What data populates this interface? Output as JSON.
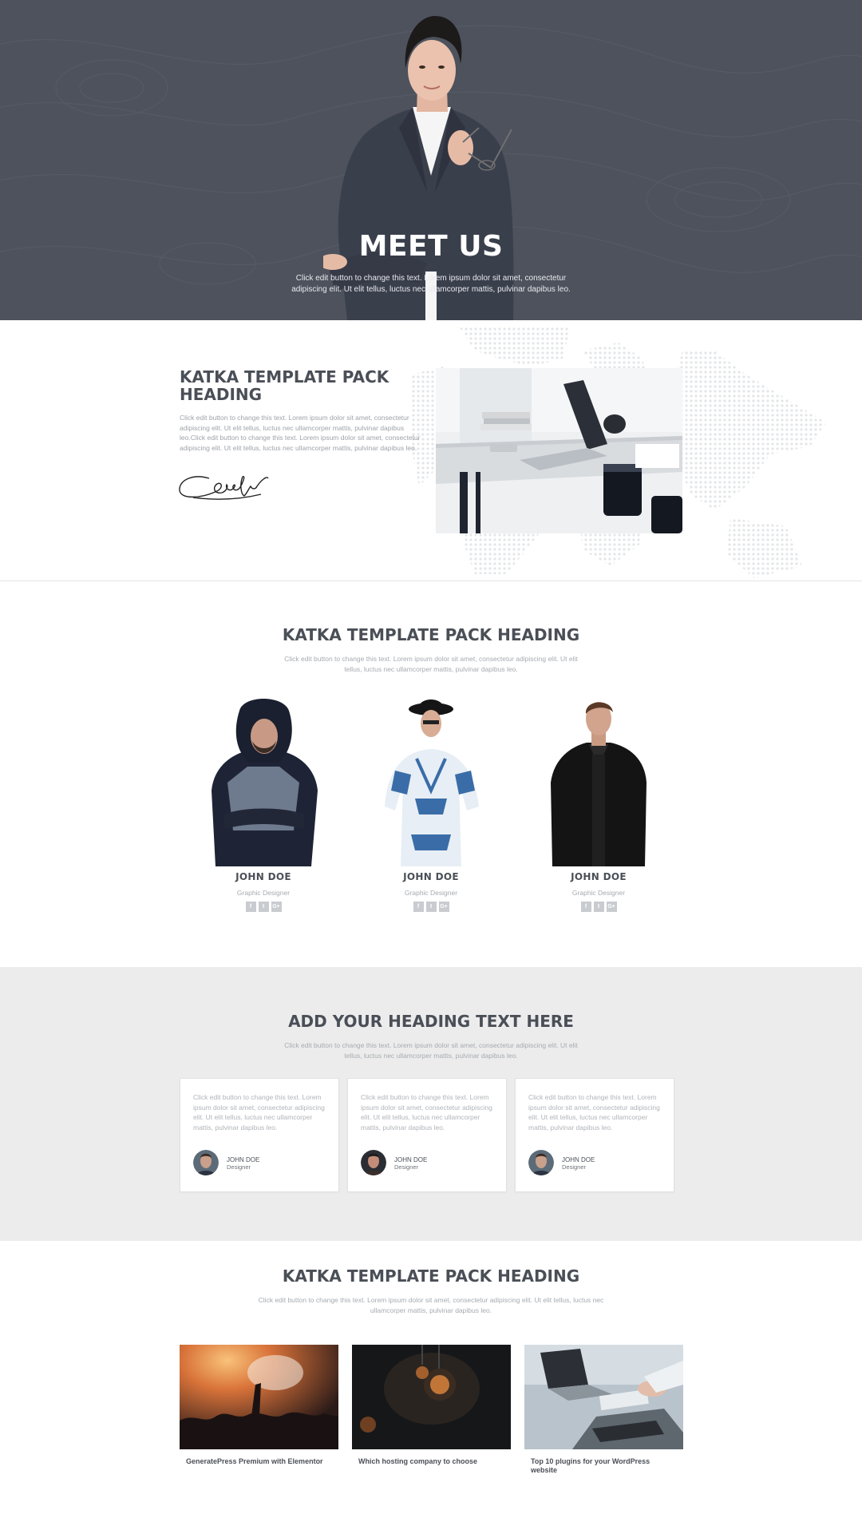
{
  "hero": {
    "title": "MEET US",
    "text": "Click edit button to change this text. Lorem ipsum dolor sit amet, consectetur adipiscing elit. Ut elit tellus, luctus nec ullamcorper mattis, pulvinar dapibus leo."
  },
  "about": {
    "heading": "KATKA TEMPLATE PACK HEADING",
    "text": "Click edit button to change this text. Lorem ipsum dolor sit amet, consectetur adipiscing elit. Ut elit tellus, luctus nec ullamcorper mattis, pulvinar dapibus leo.Click edit button to change this text. Lorem ipsum dolor sit amet, consectetur adipiscing elit. Ut elit tellus, luctus nec ullamcorper mattis, pulvinar dapibus leo."
  },
  "team": {
    "heading": "KATKA TEMPLATE PACK HEADING",
    "subtext": "Click edit button to change this text. Lorem ipsum dolor sit amet, consectetur adipiscing elit. Ut elit tellus, luctus nec ullamcorper mattis, pulvinar dapibus leo.",
    "members": [
      {
        "name": "JOHN DOE",
        "role": "Graphic Designer"
      },
      {
        "name": "JOHN DOE",
        "role": "Graphic Designer"
      },
      {
        "name": "JOHN DOE",
        "role": "Graphic Designer"
      }
    ],
    "social_icons": [
      "f",
      "t",
      "G+"
    ]
  },
  "testimonials": {
    "heading": "ADD YOUR HEADING TEXT HERE",
    "subtext": "Click edit button to change this text. Lorem ipsum dolor sit amet, consectetur adipiscing elit. Ut elit tellus, luctus nec ullamcorper mattis, pulvinar dapibus leo.",
    "cards": [
      {
        "text": "Click edit button to change this text. Lorem ipsum dolor sit amet, consectetur adipiscing elit. Ut elit tellus, luctus nec ullamcorper mattis, pulvinar dapibus leo.",
        "name": "JOHN DOE",
        "role": "Designer"
      },
      {
        "text": "Click edit button to change this text. Lorem ipsum dolor sit amet, consectetur adipiscing elit. Ut elit tellus, luctus nec ullamcorper mattis, pulvinar dapibus leo.",
        "name": "JOHN DOE",
        "role": "Designer"
      },
      {
        "text": "Click edit button to change this text. Lorem ipsum dolor sit amet, consectetur adipiscing elit. Ut elit tellus, luctus nec ullamcorper mattis, pulvinar dapibus leo.",
        "name": "JOHN DOE",
        "role": "Designer"
      }
    ]
  },
  "blog": {
    "heading": "KATKA TEMPLATE PACK HEADING",
    "subtext": "Click edit button to change this text. Lorem ipsum dolor sit amet, consectetur adipiscing elit. Ut elit tellus, luctus nec ullamcorper mattis, pulvinar dapibus leo.",
    "posts": [
      {
        "title": "GeneratePress Premium with Elementor"
      },
      {
        "title": "Which hosting company to choose"
      },
      {
        "title": "Top 10 plugins for your WordPress website"
      }
    ]
  },
  "colors": {
    "hero_bg": "#4d525c",
    "heading": "#4a4f57",
    "body_text": "#9ea3a9",
    "testimonial_bg": "#ececec"
  }
}
